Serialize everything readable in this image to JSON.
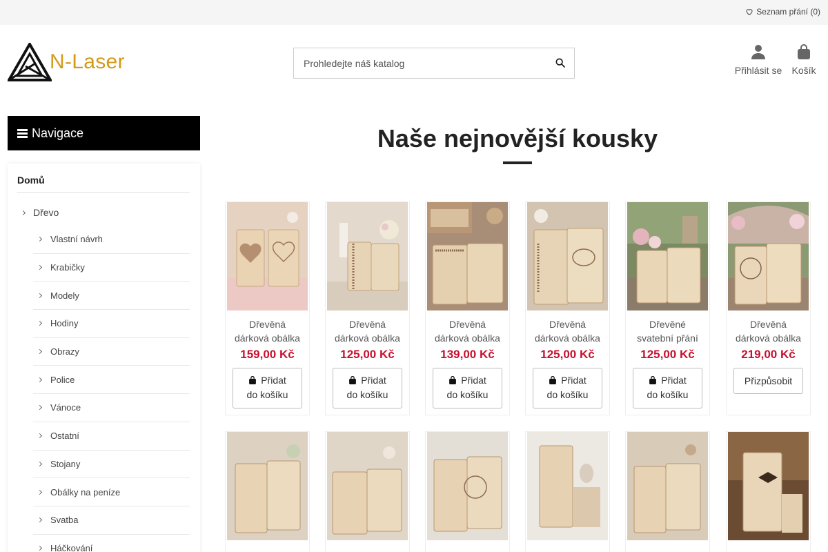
{
  "topbar": {
    "wishlist_label": "Seznam přání (0)"
  },
  "logo": {
    "text": "N-Laser"
  },
  "search": {
    "placeholder": "Prohledejte náš katalog"
  },
  "header": {
    "login_label": "Přihlásit se",
    "cart_label": "Košík"
  },
  "nav": {
    "heading": "Navigace",
    "home": "Domů",
    "top_item": "Dřevo",
    "sub_items": [
      "Vlastní návrh",
      "Krabičky",
      "Modely",
      "Hodiny",
      "Obrazy",
      "Police",
      "Vánoce",
      "Ostatní",
      "Stojany",
      "Obálky na peníze",
      "Svatba",
      "Háčkování"
    ]
  },
  "section_title": "Naše nejnovější kousky",
  "products": [
    {
      "name1": "Dřevěná",
      "name2": "dárková obálka",
      "price": "159,00 Kč",
      "button1": "Přidat",
      "button2": "do košíku"
    },
    {
      "name1": "Dřevěná",
      "name2": "dárková obálka",
      "price": "125,00 Kč",
      "button1": "Přidat",
      "button2": "do košíku"
    },
    {
      "name1": "Dřevěná",
      "name2": "dárková obálka",
      "price": "139,00 Kč",
      "button1": "Přidat",
      "button2": "do košíku"
    },
    {
      "name1": "Dřevěná",
      "name2": "dárková obálka",
      "price": "125,00 Kč",
      "button1": "Přidat",
      "button2": "do košíku"
    },
    {
      "name1": "Dřevěné",
      "name2": "svatební přání",
      "price": "125,00 Kč",
      "button1": "Přidat",
      "button2": "do košíku"
    },
    {
      "name1": "Dřevěná",
      "name2": "dárková obálka",
      "price": "219,00 Kč",
      "button1": "Přizpůsobit",
      "button2": ""
    }
  ],
  "colors": {
    "price": "#c8102e",
    "logo": "#d49a1a",
    "nav_bg": "#000000"
  }
}
